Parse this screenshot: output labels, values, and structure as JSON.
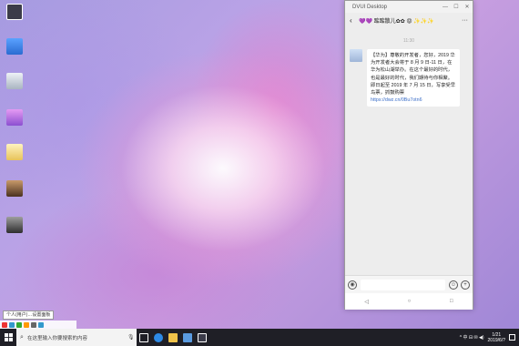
{
  "desktop": {
    "icons": [
      {
        "label": "",
        "color": "#3c3c4a"
      },
      {
        "label": "",
        "color": "#2a6bd1"
      },
      {
        "label": "",
        "color": "#cfd6de"
      },
      {
        "label": "",
        "color": "#b56ad8"
      },
      {
        "label": "",
        "color": "#e7d27a"
      },
      {
        "label": "",
        "color": "#6b4a2e"
      },
      {
        "label": "",
        "color": "#3d3d3d"
      }
    ]
  },
  "window": {
    "title": "DVUI Desktop",
    "controls": {
      "minimize": "—",
      "maximize": "☐",
      "close": "✕"
    }
  },
  "chat": {
    "back_icon": "‹",
    "name": "💜💜 踮踮散儿✿✿ 😡 ✨✨✨",
    "more_icon": "···",
    "timestamp": "11:30",
    "message": {
      "text": "【华为】尊敬的开发者，您好，2019 华为开发者大会将于 8 月 9 日-11 日，在华为松山湖举办。在这个最好的时代，也是最好的时代，我们期待与你相聚。即日起至 2019 年 7 月 15 日，写享受早鸟票，抓鼓购票",
      "link": "https://dwz.cn/0Bu7otn6"
    }
  },
  "input": {
    "voice_icon": "◉",
    "emoji_icon": "☺",
    "plus_icon": "+"
  },
  "navbar": {
    "back": "◁",
    "home": "○",
    "recent": "□"
  },
  "tooltip": {
    "text": "个人(用户)…设置面板"
  },
  "taskbar": {
    "search_placeholder": "在这里输入你要搜索的内容",
    "mic_icon": "🎙",
    "apps": [
      {
        "name": "task-view",
        "color": "#ffffff"
      },
      {
        "name": "edge",
        "color": "#2d8ae6"
      },
      {
        "name": "explorer",
        "color": "#f0c34a"
      },
      {
        "name": "store",
        "color": "#5a9be0"
      },
      {
        "name": "dvui",
        "color": "#3c3c4a"
      }
    ],
    "time": "1/21",
    "date": "2019/6/?",
    "tray_text": "^ 中 ⊟ ✉ ◀)"
  }
}
